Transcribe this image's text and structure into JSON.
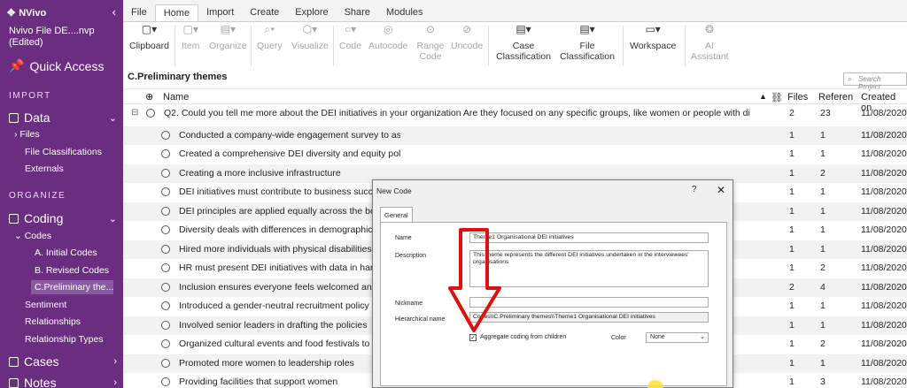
{
  "sidebar": {
    "brand": "NVivo",
    "file_title": "Nvivo File DE....nvp (Edited)",
    "quick_access": "Quick Access",
    "sections": {
      "import": "IMPORT",
      "organize": "ORGANIZE"
    },
    "data": {
      "label": "Data",
      "items": [
        "Files",
        "File Classifications",
        "Externals"
      ]
    },
    "coding": {
      "label": "Coding",
      "codes_label": "Codes",
      "codes": [
        "A. Initial Codes",
        "B. Revised Codes",
        "C.Preliminary the..."
      ],
      "items": [
        "Sentiment",
        "Relationships",
        "Relationship Types"
      ]
    },
    "cases": "Cases",
    "notes": "Notes"
  },
  "ribbon": {
    "tabs": [
      "File",
      "Home",
      "Import",
      "Create",
      "Explore",
      "Share",
      "Modules"
    ],
    "active_tab": "Home",
    "tools": {
      "clipboard": "Clipboard",
      "item": "Item",
      "organize": "Organize",
      "query": "Query",
      "visualize": "Visualize",
      "code": "Code",
      "autocode": "Autocode",
      "range_code": "Range Code",
      "uncode": "Uncode",
      "case_classification": "Case Classification",
      "file_classification": "File Classification",
      "workspace": "Workspace",
      "ai_assistant": "AI Assistant"
    }
  },
  "content": {
    "title": "C.Preliminary themes",
    "search_placeholder": "Search Project",
    "columns": {
      "name": "Name",
      "files": "Files",
      "refs": "Referen",
      "created": "Created on"
    },
    "rows": [
      {
        "name": "Q2. Could you tell me more about the DEI initiatives in your organization Are they focused on any specific groups, like women or people with di",
        "files": "2",
        "refs": "23",
        "date": "11/08/2020"
      },
      {
        "name": "Conducted a company-wide engagement survey to assess employee satisfaction",
        "files": "1",
        "refs": "1",
        "date": "11/08/2020"
      },
      {
        "name": "Created a comprehensive DEI diversity and equity policy",
        "files": "1",
        "refs": "1",
        "date": "11/08/2020"
      },
      {
        "name": "Creating a more inclusive infrastructure",
        "files": "1",
        "refs": "2",
        "date": "11/08/2020"
      },
      {
        "name": "DEI initiatives must contribute to business succe",
        "files": "1",
        "refs": "1",
        "date": "11/08/2020"
      },
      {
        "name": "DEI principles are applied equally across the boa",
        "files": "1",
        "refs": "1",
        "date": "11/08/2020"
      },
      {
        "name": "Diversity deals with differences in demographics",
        "files": "1",
        "refs": "1",
        "date": "11/08/2020"
      },
      {
        "name": "Hired more individuals with physical disabilities",
        "files": "1",
        "refs": "1",
        "date": "11/08/2020"
      },
      {
        "name": "HR must present DEI initiatives with data in hand",
        "files": "1",
        "refs": "2",
        "date": "11/08/2020"
      },
      {
        "name": "Inclusion ensures everyone feels welcomed and",
        "files": "2",
        "refs": "4",
        "date": "11/08/2020"
      },
      {
        "name": "Introduced a gender-neutral recruitment policy",
        "files": "1",
        "refs": "1",
        "date": "11/08/2020"
      },
      {
        "name": "Involved senior leaders in drafting the policies",
        "files": "1",
        "refs": "1",
        "date": "11/08/2020"
      },
      {
        "name": "Organized cultural events and food festivals to",
        "files": "1",
        "refs": "2",
        "date": "11/08/2020"
      },
      {
        "name": "Promoted more women to leadership roles",
        "files": "1",
        "refs": "1",
        "date": "11/08/2020"
      },
      {
        "name": "Providing facilities that support women",
        "files": "1",
        "refs": "3",
        "date": "11/08/2020"
      }
    ]
  },
  "dialog": {
    "title": "New Code",
    "help": "?",
    "close": "✕",
    "tab": "General",
    "name_label": "Name",
    "name_value": "Theme1 Organisational DEI initiatives",
    "description_label": "Description",
    "description_value": "This theme represents the different DEI initiatives undertaken in the interviewees' organisations",
    "nickname_label": "Nickname",
    "nickname_value": "",
    "hier_label": "Hierarchical name",
    "hier_value": "Codes\\\\C.Preliminary themes\\\\Theme1 Organisational DEI initiatives",
    "aggregate_label": "Aggregate coding from children",
    "aggregate_checked": true,
    "color_label": "Color",
    "color_value": "None"
  },
  "colors": {
    "sidebar": "#6a2d80",
    "annotation_arrow": "#e01010"
  }
}
